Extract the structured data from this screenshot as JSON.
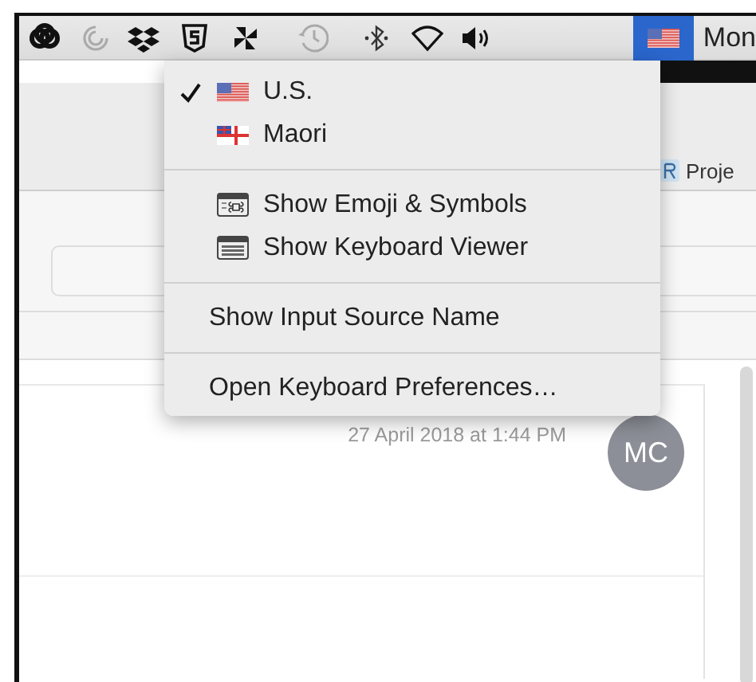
{
  "menu_bar": {
    "input_menu_open": true,
    "clock": "Mon"
  },
  "input_menu": {
    "sources": [
      {
        "label": "U.S.",
        "kind": "us",
        "selected": true
      },
      {
        "label": "Maori",
        "kind": "maori",
        "selected": false
      }
    ],
    "tools": [
      {
        "label": "Show Emoji & Symbols",
        "kind": "emoji"
      },
      {
        "label": "Show Keyboard Viewer",
        "kind": "keyboard"
      }
    ],
    "items": [
      "Show Input Source Name",
      "Open Keyboard Preferences…"
    ]
  },
  "window": {
    "tab": "Proje",
    "message": {
      "timestamp": "27 April 2018 at 1:44 PM",
      "avatar": "MC"
    }
  }
}
